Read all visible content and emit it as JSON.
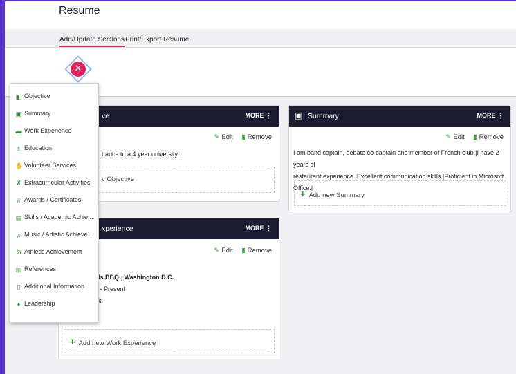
{
  "header": {
    "title": "Resume"
  },
  "tabs": [
    {
      "label": "Add/Update Sections",
      "active": true
    },
    {
      "label": "Print/Export Resume",
      "active": false
    }
  ],
  "close_button": {
    "symbol": "✕"
  },
  "dropdown": {
    "items": [
      {
        "label": "Objective",
        "icon": "book-icon"
      },
      {
        "label": "Summary",
        "icon": "briefcase-icon"
      },
      {
        "label": "Work Experience",
        "icon": "briefcase-icon"
      },
      {
        "label": "Education",
        "icon": "graduation-icon"
      },
      {
        "label": "Volunteer Services",
        "icon": "hand-icon"
      },
      {
        "label": "Extracurricular Activities",
        "icon": "activity-icon"
      },
      {
        "label": "Awards / Certificates",
        "icon": "award-icon"
      },
      {
        "label": "Skills / Academic Achie...",
        "icon": "skills-icon"
      },
      {
        "label": "Music / Artistic Achieve...",
        "icon": "music-icon"
      },
      {
        "label": "Athletic Achievement",
        "icon": "athletic-icon"
      },
      {
        "label": "References",
        "icon": "references-icon"
      },
      {
        "label": "Additional Information",
        "icon": "info-icon"
      },
      {
        "label": "Leadership",
        "icon": "leadership-icon"
      }
    ]
  },
  "objective_card": {
    "title": "ve",
    "more": "MORE ⋮",
    "edit": "Edit",
    "remove": "Remove",
    "text": "ttance to a 4 year university.",
    "add": "v Objective"
  },
  "summary_card": {
    "icon": "briefcase-icon",
    "title": "Summary",
    "more": "MORE ⋮",
    "edit": "Edit",
    "remove": "Remove",
    "text_line1": "I am band captain, debate co-captain and member of French club.|I have 2 years of",
    "text_line2": "restaurant experience.|Excellent communication skills.|Proficient in Microsoft Office.|",
    "add": "Add new Summary"
  },
  "work_card": {
    "title": "xperience",
    "more": "MORE ⋮",
    "edit": "Edit",
    "remove": "Remove",
    "employer": "ills BBQ , Washington D.C.",
    "dates": "5 - Present",
    "extra": "ek",
    "add": "Add new Work Experience"
  },
  "colors": {
    "accent": "#e0245e",
    "header": "#1c1c32",
    "green": "#3f9d40",
    "frame": "#5a35c9"
  }
}
